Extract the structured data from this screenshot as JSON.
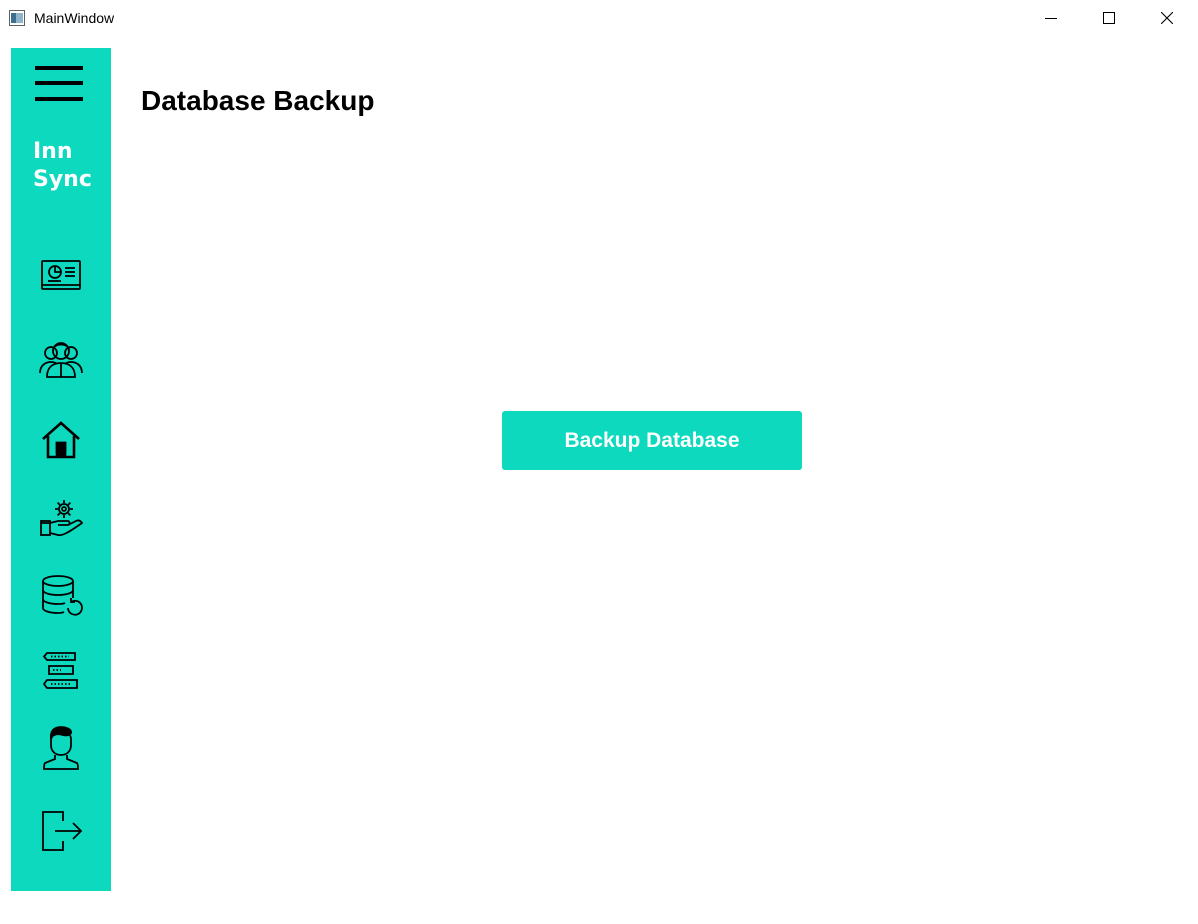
{
  "window": {
    "title": "MainWindow",
    "controls": {
      "minimize_icon": "minimize-icon",
      "maximize_icon": "maximize-icon",
      "close_icon": "close-icon"
    }
  },
  "sidebar": {
    "background": "#0dd9bf",
    "menu_icon": "hamburger-menu-icon",
    "brand_line1": "Inn",
    "brand_line2": "Sync",
    "items": [
      {
        "icon": "dashboard-icon"
      },
      {
        "icon": "guests-icon"
      },
      {
        "icon": "home-icon"
      },
      {
        "icon": "services-icon"
      },
      {
        "icon": "database-backup-icon"
      },
      {
        "icon": "logs-icon"
      },
      {
        "icon": "user-profile-icon"
      },
      {
        "icon": "logout-icon"
      }
    ]
  },
  "main": {
    "title": "Database Backup",
    "backup_button_label": "Backup Database"
  },
  "colors": {
    "accent": "#0dd9bf",
    "button_text": "#ffffff",
    "title_text": "#000000"
  }
}
